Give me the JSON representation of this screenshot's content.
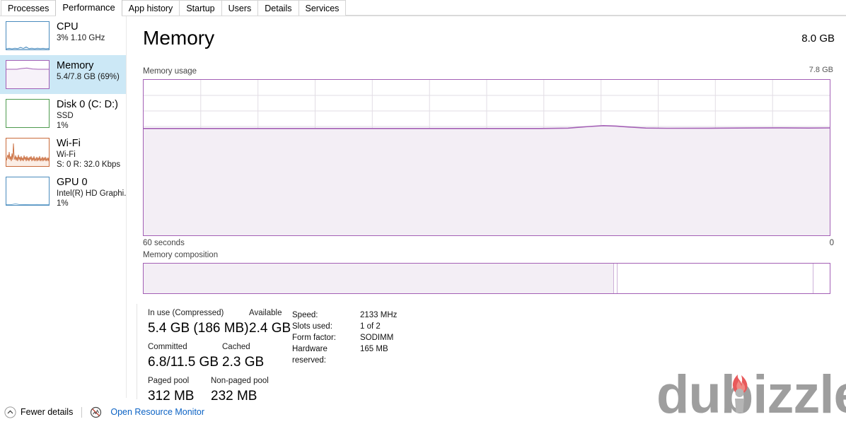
{
  "tabs": [
    {
      "label": "Processes",
      "selected": false
    },
    {
      "label": "Performance",
      "selected": true
    },
    {
      "label": "App history",
      "selected": false
    },
    {
      "label": "Startup",
      "selected": false
    },
    {
      "label": "Users",
      "selected": false
    },
    {
      "label": "Details",
      "selected": false
    },
    {
      "label": "Services",
      "selected": false
    }
  ],
  "sidebar": {
    "items": [
      {
        "name": "cpu",
        "title": "CPU",
        "sub1": "3%  1.10 GHz",
        "sub2": "",
        "color": "#4a8bbd",
        "fill": "#f2f7fb",
        "selected": false,
        "icon": "cpu-thumbnail"
      },
      {
        "name": "memory",
        "title": "Memory",
        "sub1": "5.4/7.8 GB (69%)",
        "sub2": "",
        "color": "#a35fb5",
        "fill": "#f7f3f8",
        "selected": true,
        "icon": "memory-thumbnail"
      },
      {
        "name": "disk0",
        "title": "Disk 0 (C: D:)",
        "sub1": "SSD",
        "sub2": "1%",
        "color": "#4e9a4e",
        "fill": "#ffffff",
        "selected": false,
        "icon": "disk-thumbnail"
      },
      {
        "name": "wifi",
        "title": "Wi-Fi",
        "sub1": "Wi-Fi",
        "sub2": "S: 0 R: 32.0 Kbps",
        "color": "#c96a3a",
        "fill": "#fdf4ef",
        "selected": false,
        "icon": "wifi-thumbnail"
      },
      {
        "name": "gpu0",
        "title": "GPU 0",
        "sub1": "Intel(R) HD Graphi...",
        "sub2": "1%",
        "color": "#4a8bbd",
        "fill": "#ffffff",
        "selected": false,
        "icon": "gpu-thumbnail"
      }
    ]
  },
  "main": {
    "title": "Memory",
    "total_memory": "8.0 GB",
    "usage_label": "Memory usage",
    "scale_label": "7.8 GB",
    "time_label": "60 seconds",
    "zero_label": "0",
    "composition_label": "Memory composition",
    "accent_color": "#a35fb5",
    "fill_color": "#f3eef5"
  },
  "chart_data": {
    "type": "area",
    "title": "Memory usage",
    "xlabel": "60 seconds",
    "ylabel": "",
    "ylim": [
      0,
      7.8
    ],
    "xlim": [
      60,
      0
    ],
    "grid": true,
    "series": [
      {
        "name": "In use memory (GB)",
        "values": [
          5.38,
          5.38,
          5.38,
          5.38,
          5.38,
          5.38,
          5.38,
          5.38,
          5.38,
          5.38,
          5.38,
          5.38,
          5.38,
          5.38,
          5.38,
          5.38,
          5.38,
          5.38,
          5.38,
          5.38,
          5.38,
          5.38,
          5.38,
          5.38,
          5.38,
          5.38,
          5.38,
          5.38,
          5.38,
          5.38,
          5.38,
          5.38,
          5.39,
          5.39,
          5.39,
          5.39,
          5.4,
          5.42,
          5.45,
          5.47,
          5.47,
          5.46,
          5.45,
          5.44,
          5.44,
          5.44,
          5.44,
          5.44,
          5.44,
          5.44,
          5.44,
          5.44,
          5.44,
          5.44,
          5.44,
          5.45,
          5.45,
          5.45,
          5.45,
          5.45
        ]
      }
    ],
    "current_percent": 69
  },
  "composition": {
    "segments": [
      {
        "name": "in-use",
        "percent": 68.5,
        "color": "#f3eef5"
      },
      {
        "name": "modified",
        "percent": 0.35,
        "color": "#ffffff"
      },
      {
        "name": "standby-cached",
        "percent": 28.6,
        "color": "#ffffff"
      },
      {
        "name": "free",
        "percent": 2.4,
        "color": "#ffffff"
      }
    ]
  },
  "stats": {
    "in_use_label": "In use (Compressed)",
    "in_use_value": "5.4 GB (186 MB)",
    "available_label": "Available",
    "available_value": "2.4 GB",
    "committed_label": "Committed",
    "committed_value": "6.8/11.5 GB",
    "cached_label": "Cached",
    "cached_value": "2.3 GB",
    "paged_pool_label": "Paged pool",
    "paged_pool_value": "312 MB",
    "non_paged_pool_label": "Non-paged pool",
    "non_paged_pool_value": "232 MB",
    "details": [
      {
        "key": "Speed:",
        "value": "2133 MHz"
      },
      {
        "key": "Slots used:",
        "value": "1 of 2"
      },
      {
        "key": "Form factor:",
        "value": "SODIMM"
      },
      {
        "key": "Hardware reserved:",
        "value": "165 MB"
      }
    ]
  },
  "footer": {
    "fewer_details": "Fewer details",
    "resource_monitor": "Open Resource Monitor",
    "link_color": "#0b62c4"
  },
  "watermark": {
    "text": "dubizzle",
    "color": "#9e9e9e",
    "flame_color": "#e8595b"
  }
}
